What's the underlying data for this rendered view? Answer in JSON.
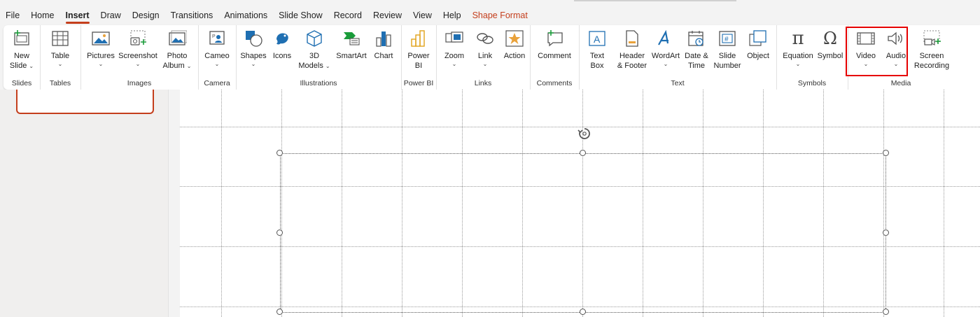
{
  "tabs": [
    "File",
    "Home",
    "Insert",
    "Draw",
    "Design",
    "Transitions",
    "Animations",
    "Slide Show",
    "Record",
    "Review",
    "View",
    "Help",
    "Shape Format"
  ],
  "active_tab": "Insert",
  "groups": {
    "slides": {
      "label": "Slides",
      "new_slide_l1": "New",
      "new_slide_l2": "Slide"
    },
    "tables": {
      "label": "Tables",
      "table": "Table"
    },
    "images": {
      "label": "Images",
      "pictures": "Pictures",
      "screenshot": "Screenshot",
      "photo_album_l1": "Photo",
      "photo_album_l2": "Album"
    },
    "camera": {
      "label": "Camera",
      "cameo": "Cameo"
    },
    "illustrations": {
      "label": "Illustrations",
      "shapes": "Shapes",
      "icons": "Icons",
      "models_l1": "3D",
      "models_l2": "Models",
      "smartart": "SmartArt",
      "chart": "Chart"
    },
    "powerbi": {
      "label": "Power BI",
      "pb_l1": "Power",
      "pb_l2": "BI"
    },
    "links": {
      "label": "Links",
      "zoom": "Zoom",
      "link": "Link",
      "action": "Action"
    },
    "comments": {
      "label": "Comments",
      "comment": "Comment"
    },
    "text": {
      "label": "Text",
      "textbox_l1": "Text",
      "textbox_l2": "Box",
      "header_l1": "Header",
      "header_l2": "& Footer",
      "wordart": "WordArt",
      "date_l1": "Date &",
      "date_l2": "Time",
      "slidenum_l1": "Slide",
      "slidenum_l2": "Number",
      "object": "Object"
    },
    "symbols": {
      "label": "Symbols",
      "equation": "Equation",
      "symbol": "Symbol"
    },
    "media": {
      "label": "Media",
      "video": "Video",
      "audio": "Audio",
      "screen_l1": "Screen",
      "screen_l2": "Recording"
    }
  },
  "colors": {
    "accent": "#c43e1c",
    "icon_blue": "#1f6fb2",
    "highlight": "#e60000"
  }
}
